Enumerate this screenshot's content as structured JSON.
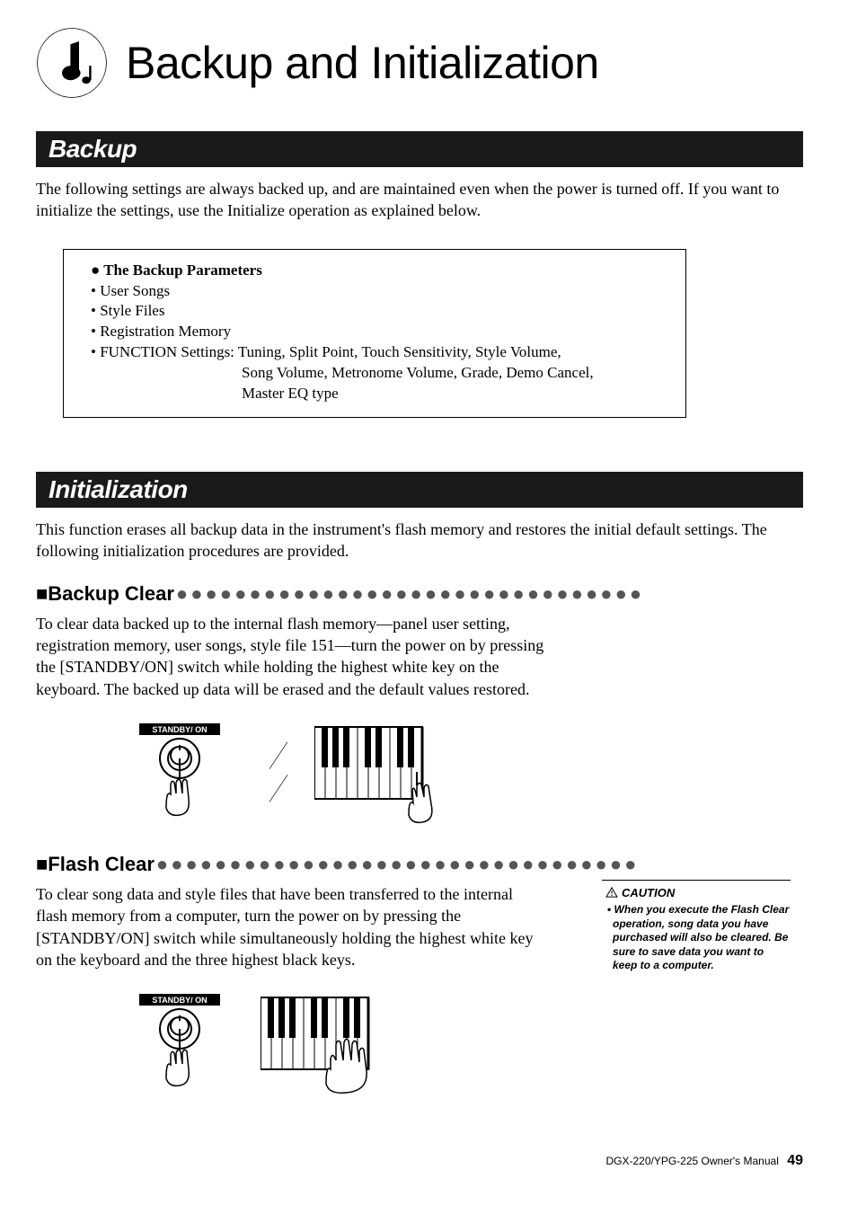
{
  "title": "Backup and Initialization",
  "backup": {
    "heading": "Backup",
    "intro": "The following settings are always backed up, and are maintained even when the power is turned off. If you want to initialize the settings, use the Initialize operation as explained below.",
    "box": {
      "title": "The Backup Parameters",
      "item1": "User Songs",
      "item2": "Style Files",
      "item3": "Registration Memory",
      "function_line1": "FUNCTION Settings: Tuning, Split Point, Touch Sensitivity, Style Volume,",
      "function_line2": "Song Volume, Metronome Volume, Grade, Demo Cancel,",
      "function_line3": "Master EQ type"
    }
  },
  "initialization": {
    "heading": "Initialization",
    "intro": "This function erases all backup data in the instrument's flash memory and restores the initial default settings. The following initialization procedures are provided.",
    "backup_clear": {
      "title": "Backup Clear",
      "dots": "●●●●●●●●●●●●●●●●●●●●●●●●●●●●●●●●",
      "body": "To clear data backed up to the internal flash memory—panel user setting, registration memory, user songs, style file 151—turn the power on by pressing the [STANDBY/ON] switch while holding the highest white key on the keyboard. The backed up data will be erased and the default values restored."
    },
    "flash_clear": {
      "title": "Flash Clear",
      "dots": " ●●●●●●●●●●●●●●●●●●●●●●●●●●●●●●●●●",
      "body": "To clear song data and style files that have been transferred to the internal flash memory from a computer, turn the power on by pressing the [STANDBY/ON] switch while simultaneously holding the highest white key on the keyboard and the three highest black keys."
    }
  },
  "caution": {
    "label": "CAUTION",
    "text": "When you execute the Flash Clear operation, song data you have purchased will also be cleared. Be sure to save data you want to keep to a computer."
  },
  "footer": {
    "manual": "DGX-220/YPG-225  Owner's Manual",
    "page": "49"
  },
  "diagram_labels": {
    "standby_button": "STANDBY/    ON"
  }
}
